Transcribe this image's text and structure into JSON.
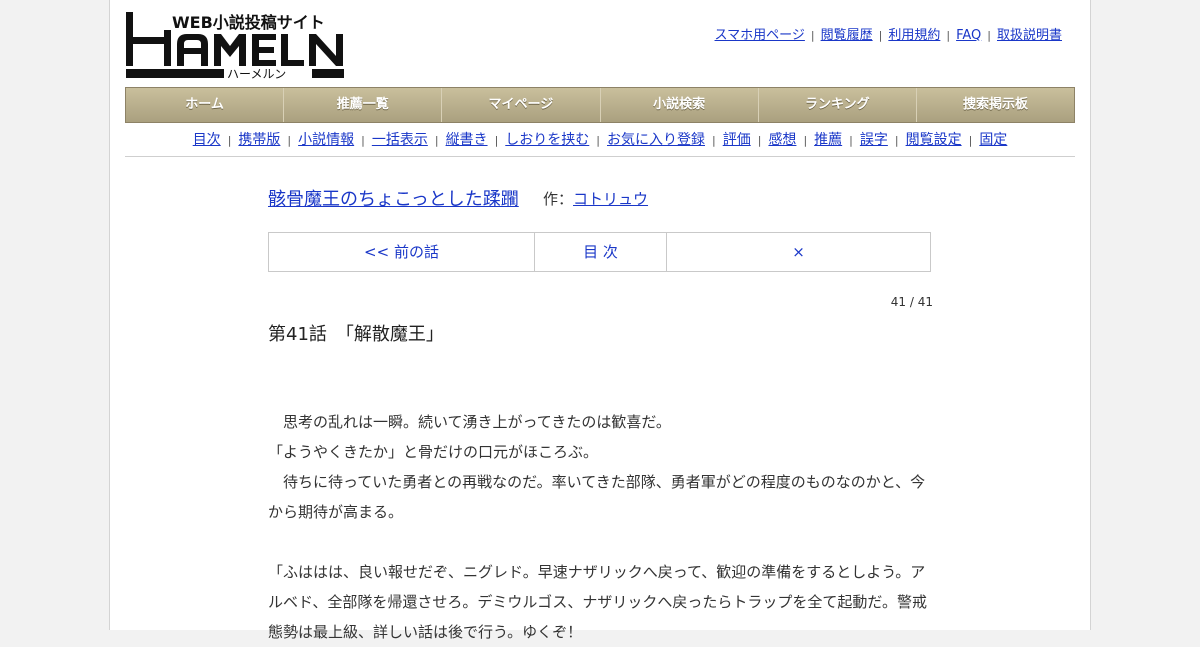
{
  "logo": {
    "tagline": "WEB小説投稿サイト",
    "name": "HAMELN",
    "kana": "ハーメルン"
  },
  "header_links": [
    "スマホ用ページ",
    "閲覧履歴",
    "利用規約",
    "FAQ",
    "取扱説明書"
  ],
  "nav": [
    "ホーム",
    "推薦一覧",
    "マイページ",
    "小説検索",
    "ランキング",
    "捜索掲示板"
  ],
  "subnav": [
    "目次",
    "携帯版",
    "小説情報",
    "一括表示",
    "縦書き",
    "しおりを挟む",
    "お気に入り登録",
    "評価",
    "感想",
    "推薦",
    "誤字",
    "閲覧設定",
    "固定"
  ],
  "novel": {
    "title": "骸骨魔王のちょこっとした蹂躙",
    "author_prefix": "作：",
    "author": "コトリュウ"
  },
  "pager": {
    "prev": "<< 前の話",
    "toc": "目 次",
    "close": "×"
  },
  "chapter": {
    "count": "41 / 41",
    "title": "第41話　「解散魔王」"
  },
  "paragraphs": [
    "　思考の乱れは一瞬。続いて湧き上がってきたのは歓喜だ。",
    "「ようやくきたか」と骨だけの口元がほころぶ。",
    "　待ちに待っていた勇者との再戦なのだ。率いてきた部隊、勇者軍がどの程度のものなのかと、今から期待が高まる。",
    "",
    "「ふははは、良い報せだぞ、ニグレド。早速ナザリックへ戻って、歓迎の準備をするとしよう。アルベド、全部隊を帰還させろ。デミウルゴス、ナザリックへ戻ったらトラップを全て起動だ。警戒態勢は最上級、詳しい話は後で行う。ゆくぞ！"
  ]
}
